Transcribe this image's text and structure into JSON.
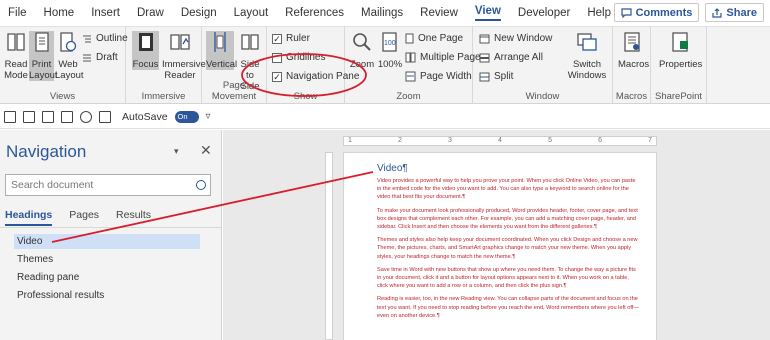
{
  "menu": {
    "items": [
      "File",
      "Home",
      "Insert",
      "Draw",
      "Design",
      "Layout",
      "References",
      "Mailings",
      "Review",
      "View",
      "Developer",
      "Help"
    ],
    "active": "View",
    "comments_label": "Comments",
    "share_label": "Share"
  },
  "ribbon": {
    "views": {
      "label": "Views",
      "read_mode": "Read Mode",
      "print_layout": "Print Layout",
      "web_layout": "Web Layout",
      "outline": "Outline",
      "draft": "Draft"
    },
    "immersive": {
      "label": "Immersive",
      "focus": "Focus",
      "immersive_reader": "Immersive Reader"
    },
    "page_movement": {
      "label": "Page Movement",
      "vertical": "Vertical",
      "side_to_side": "Side to Side"
    },
    "show": {
      "label": "Show",
      "ruler": "Ruler",
      "gridlines": "Gridlines",
      "navigation_pane": "Navigation Pane"
    },
    "zoom": {
      "label": "Zoom",
      "zoom": "Zoom",
      "hundred": "100%",
      "one_page": "One Page",
      "multiple_pages": "Multiple Pages",
      "page_width": "Page Width"
    },
    "window": {
      "label": "Window",
      "new_window": "New Window",
      "arrange_all": "Arrange All",
      "split": "Split",
      "switch_windows": "Switch Windows"
    },
    "macros": {
      "label": "Macros",
      "macros": "Macros"
    },
    "sharepoint": {
      "label": "SharePoint",
      "properties": "Properties"
    }
  },
  "qat": {
    "autosave_label": "AutoSave",
    "autosave_state": "On"
  },
  "nav": {
    "title": "Navigation",
    "search_placeholder": "Search document",
    "tabs": [
      "Headings",
      "Pages",
      "Results"
    ],
    "items": [
      "Video",
      "Themes",
      "Reading pane",
      "Professional results"
    ]
  },
  "ruler": {
    "ticks": [
      "1",
      "2",
      "3",
      "4",
      "5",
      "6",
      "7"
    ]
  },
  "document": {
    "heading": "Video¶",
    "paragraphs": [
      "Video provides a powerful way to help you prove your point. When you click Online Video, you can paste in the embed code for the video you want to add. You can also type a keyword to search online for the video that best fits your document.¶",
      "To make your document look professionally produced, Word provides header, footer, cover page, and text box designs that complement each other. For example, you can add a matching cover page, header, and sidebar. Click Insert and then choose the elements you want from the different galleries.¶",
      "Themes and styles also help keep your document coordinated. When you click Design and choose a new Theme, the pictures, charts, and SmartArt graphics change to match your new theme. When you apply styles, your headings change to match the new theme.¶",
      "Save time in Word with new buttons that show up where you need them. To change the way a picture fits in your document, click it and a button for layout options appears next to it. When you work on a table, click where you want to add a row or a column, and then click the plus sign.¶",
      "Reading is easier, too, in the new Reading view. You can collapse parts of the document and focus on the text you want. If you need to stop reading before you reach the end, Word remembers where you left off—even on another device.¶"
    ]
  },
  "colors": {
    "accent": "#2b579a",
    "doc_text": "#c0232c",
    "annotation": "#d81e2c"
  }
}
